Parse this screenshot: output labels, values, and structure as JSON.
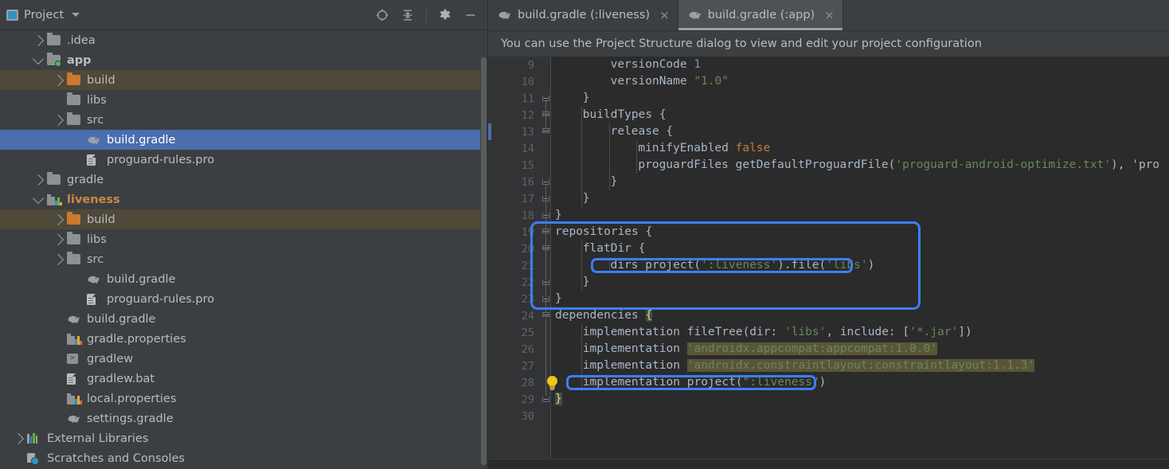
{
  "toolwindow": {
    "title": "Project",
    "dropdown_icon": "chevron-down-icon",
    "actions": [
      {
        "name": "locate-icon",
        "label": "Select Opened File"
      },
      {
        "name": "collapse-all-icon",
        "label": "Collapse All"
      },
      {
        "name": "gear-icon",
        "label": "Settings"
      },
      {
        "name": "minimize-icon",
        "label": "Hide"
      }
    ]
  },
  "tree": [
    {
      "label": ".idea",
      "depth": 1,
      "icon": "folder-icon",
      "arrow": "collapsed",
      "state": "normal"
    },
    {
      "label": "app",
      "depth": 1,
      "icon": "module-folder-icon",
      "arrow": "expanded",
      "state": "module"
    },
    {
      "label": "build",
      "depth": 2,
      "icon": "folder-orange-icon",
      "arrow": "collapsed",
      "state": "excluded"
    },
    {
      "label": "libs",
      "depth": 2,
      "icon": "folder-icon",
      "arrow": "none",
      "state": "normal"
    },
    {
      "label": "src",
      "depth": 2,
      "icon": "folder-icon",
      "arrow": "collapsed",
      "state": "normal"
    },
    {
      "label": "build.gradle",
      "depth": 3,
      "icon": "gradle-file-icon",
      "arrow": "none",
      "state": "selected"
    },
    {
      "label": "proguard-rules.pro",
      "depth": 3,
      "icon": "file-icon",
      "arrow": "none",
      "state": "normal"
    },
    {
      "label": "gradle",
      "depth": 1,
      "icon": "folder-icon",
      "arrow": "collapsed",
      "state": "normal"
    },
    {
      "label": "liveness",
      "depth": 1,
      "icon": "module-bars-icon",
      "arrow": "expanded",
      "state": "module-modified"
    },
    {
      "label": "build",
      "depth": 2,
      "icon": "folder-orange-icon",
      "arrow": "collapsed",
      "state": "excluded"
    },
    {
      "label": "libs",
      "depth": 2,
      "icon": "folder-icon",
      "arrow": "collapsed",
      "state": "normal"
    },
    {
      "label": "src",
      "depth": 2,
      "icon": "folder-icon",
      "arrow": "collapsed",
      "state": "normal"
    },
    {
      "label": "build.gradle",
      "depth": 3,
      "icon": "gradle-file-icon",
      "arrow": "none",
      "state": "normal"
    },
    {
      "label": "proguard-rules.pro",
      "depth": 3,
      "icon": "file-icon",
      "arrow": "none",
      "state": "normal"
    },
    {
      "label": "build.gradle",
      "depth": 2,
      "icon": "gradle-file-icon",
      "arrow": "none",
      "state": "normal"
    },
    {
      "label": "gradle.properties",
      "depth": 2,
      "icon": "properties-icon",
      "arrow": "none",
      "state": "normal"
    },
    {
      "label": "gradlew",
      "depth": 2,
      "icon": "terminal-icon",
      "arrow": "none",
      "state": "normal"
    },
    {
      "label": "gradlew.bat",
      "depth": 2,
      "icon": "file-icon",
      "arrow": "none",
      "state": "normal"
    },
    {
      "label": "local.properties",
      "depth": 2,
      "icon": "properties-icon",
      "arrow": "none",
      "state": "normal"
    },
    {
      "label": "settings.gradle",
      "depth": 2,
      "icon": "gradle-file-icon",
      "arrow": "none",
      "state": "normal"
    },
    {
      "label": "External Libraries",
      "depth": 0,
      "icon": "library-icon",
      "arrow": "collapsed",
      "state": "normal"
    },
    {
      "label": "Scratches and Consoles",
      "depth": 0,
      "icon": "scratches-icon",
      "arrow": "none",
      "state": "normal"
    }
  ],
  "tabs": [
    {
      "label": "build.gradle (:liveness)",
      "icon": "gradle-file-icon",
      "close_icon": "close-icon",
      "active": false
    },
    {
      "label": "build.gradle (:app)",
      "icon": "gradle-file-icon",
      "close_icon": "close-icon",
      "active": true
    }
  ],
  "notification": {
    "text": "You can use the Project Structure dialog to view and edit your project configuration"
  },
  "editor": {
    "first_line": 9,
    "lines": [
      {
        "n": 9,
        "indent": 2,
        "text": "versionCode 1"
      },
      {
        "n": 10,
        "indent": 2,
        "text": "versionName \"1.0\""
      },
      {
        "n": 11,
        "indent": 1,
        "text": "}"
      },
      {
        "n": 12,
        "indent": 1,
        "text": "buildTypes {"
      },
      {
        "n": 13,
        "indent": 2,
        "text": "release {"
      },
      {
        "n": 14,
        "indent": 3,
        "text": "minifyEnabled false"
      },
      {
        "n": 15,
        "indent": 3,
        "text": "proguardFiles getDefaultProguardFile('proguard-android-optimize.txt'), 'proguard-rules"
      },
      {
        "n": 16,
        "indent": 2,
        "text": "}"
      },
      {
        "n": 17,
        "indent": 1,
        "text": "}"
      },
      {
        "n": 18,
        "indent": 0,
        "text": "}"
      },
      {
        "n": 19,
        "indent": 0,
        "text": "repositories {"
      },
      {
        "n": 20,
        "indent": 1,
        "text": "flatDir {"
      },
      {
        "n": 21,
        "indent": 2,
        "text": "dirs project(':liveness').file('libs')"
      },
      {
        "n": 22,
        "indent": 1,
        "text": "}"
      },
      {
        "n": 23,
        "indent": 0,
        "text": "}"
      },
      {
        "n": 24,
        "indent": 0,
        "text": "dependencies {"
      },
      {
        "n": 25,
        "indent": 1,
        "text": "implementation fileTree(dir: 'libs', include: ['*.jar'])"
      },
      {
        "n": 26,
        "indent": 1,
        "text": "implementation 'androidx.appcompat:appcompat:1.0.0'"
      },
      {
        "n": 27,
        "indent": 1,
        "text": "implementation 'androidx.constraintlayout:constraintlayout:1.1.3'"
      },
      {
        "n": 28,
        "indent": 1,
        "text": "implementation project(\":liveness\")"
      },
      {
        "n": 29,
        "indent": 0,
        "text": "}"
      },
      {
        "n": 30,
        "indent": 0,
        "text": ""
      }
    ],
    "annotations": [
      {
        "name": "repositories-block-highlight",
        "kind": "blue-rounded-box"
      },
      {
        "name": "dirs-line-highlight",
        "kind": "blue-rounded-box"
      },
      {
        "name": "implementation-project-liveness-highlight",
        "kind": "blue-rounded-box"
      }
    ],
    "intention_bulb": {
      "icon": "lightbulb-icon",
      "line": 28
    }
  },
  "colors": {
    "selection_blue": "#4b6eaf",
    "annotation_blue": "#3b7ff5",
    "excluded_folder": "#4e4938",
    "keyword_orange": "#cc7832",
    "string_green": "#6a8759",
    "number_blue": "#6897bb",
    "usage_highlight": "#5a5538",
    "editor_bg": "#2b2b2b",
    "panel_bg": "#3c3f41"
  }
}
